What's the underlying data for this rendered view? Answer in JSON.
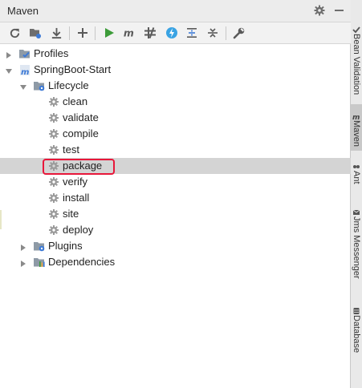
{
  "panel": {
    "title": "Maven"
  },
  "toolbar": {
    "buttons": [
      "refresh-icon",
      "generate-sources-icon",
      "download-icon",
      "add-icon",
      "run-icon",
      "maven-goal-icon",
      "skip-tests-icon",
      "offline-icon",
      "collapse-icon",
      "expand-icon",
      "settings-wrench-icon"
    ],
    "colors": {
      "run": "#3d9c3a",
      "offline": "#3aa3e3",
      "accent": "#3d7ad6"
    }
  },
  "tree": {
    "profiles": "Profiles",
    "project": "SpringBoot-Start",
    "lifecycle": "Lifecycle",
    "goals": [
      "clean",
      "validate",
      "compile",
      "test",
      "package",
      "verify",
      "install",
      "site",
      "deploy"
    ],
    "selected_goal": "package",
    "plugins": "Plugins",
    "dependencies": "Dependencies"
  },
  "sidebar": {
    "tabs": [
      "Bean Validation",
      "Maven",
      "Ant",
      "Jms Messenger",
      "Database"
    ],
    "active": "Maven"
  },
  "highlight_color": "#e8173a"
}
